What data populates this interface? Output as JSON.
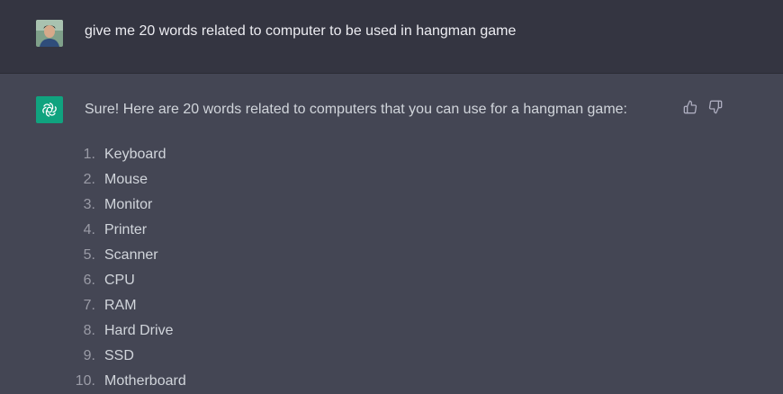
{
  "user_message": {
    "text": "give me 20 words related to computer to be used in hangman game"
  },
  "assistant_message": {
    "intro": "Sure! Here are 20 words related to computers that you can use for a hangman game:",
    "items": [
      {
        "num": "1.",
        "word": "Keyboard"
      },
      {
        "num": "2.",
        "word": "Mouse"
      },
      {
        "num": "3.",
        "word": "Monitor"
      },
      {
        "num": "4.",
        "word": "Printer"
      },
      {
        "num": "5.",
        "word": "Scanner"
      },
      {
        "num": "6.",
        "word": "CPU"
      },
      {
        "num": "7.",
        "word": "RAM"
      },
      {
        "num": "8.",
        "word": "Hard Drive"
      },
      {
        "num": "9.",
        "word": "SSD"
      },
      {
        "num": "10.",
        "word": "Motherboard"
      }
    ]
  },
  "icons": {
    "user_avatar": "user-avatar-photo",
    "bot_avatar": "openai-logo-icon",
    "thumbs_up": "thumbs-up-icon",
    "thumbs_down": "thumbs-down-icon"
  },
  "colors": {
    "user_row_bg": "#343541",
    "assistant_row_bg": "#444654",
    "bot_avatar_bg": "#10a37f"
  }
}
